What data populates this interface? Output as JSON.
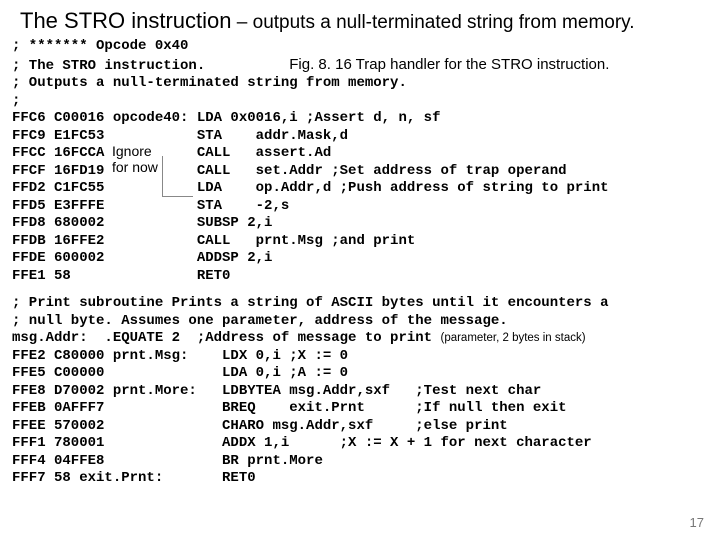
{
  "title_main": "The STRO instruction",
  "title_sub": " – outputs a null-terminated string from memory.",
  "header_comments": [
    "; ******* Opcode 0x40",
    "; The STRO instruction.",
    "; Outputs a null-terminated string from memory.",
    ";"
  ],
  "fig_caption": "Fig. 8. 16 Trap handler for the STRO instruction.",
  "note_line1": "Ignore",
  "note_line2": "for now",
  "code_block1": [
    "FFC6 C00016 opcode40: LDA 0x0016,i ;Assert d, n, sf",
    "FFC9 E1FC53           STA    addr.Mask,d",
    "FFCC 16FCCA           CALL   assert.Ad",
    "FFCF 16FD19           CALL   set.Addr ;Set address of trap operand",
    "FFD2 C1FC55           LDA    op.Addr,d ;Push address of string to print",
    "FFD5 E3FFFE           STA    -2,s",
    "FFD8 680002           SUBSP 2,i",
    "FFDB 16FFE2           CALL   prnt.Msg ;and print",
    "FFDE 600002           ADDSP 2,i",
    "FFE1 58               RET0"
  ],
  "mid_comments": [
    "; Print subroutine Prints a string of ASCII bytes until it encounters a",
    "; null byte. Assumes one parameter, address of the message."
  ],
  "equ_line_a": "msg.Addr:  .EQUATE 2  ;Address of message to print ",
  "equ_line_b": "(parameter, 2 bytes in stack)",
  "code_block2": [
    "FFE2 C80000 prnt.Msg:    LDX 0,i ;X := 0",
    "FFE5 C00000              LDA 0,i ;A := 0",
    "FFE8 D70002 prnt.More:   LDBYTEA msg.Addr,sxf   ;Test next char",
    "FFEB 0AFFF7              BREQ    exit.Prnt      ;If null then exit",
    "FFEE 570002              CHARO msg.Addr,sxf     ;else print",
    "FFF1 780001              ADDX 1,i      ;X := X + 1 for next character",
    "FFF4 04FFE8              BR prnt.More",
    "FFF7 58 exit.Prnt:       RET0"
  ],
  "page_number": "17"
}
